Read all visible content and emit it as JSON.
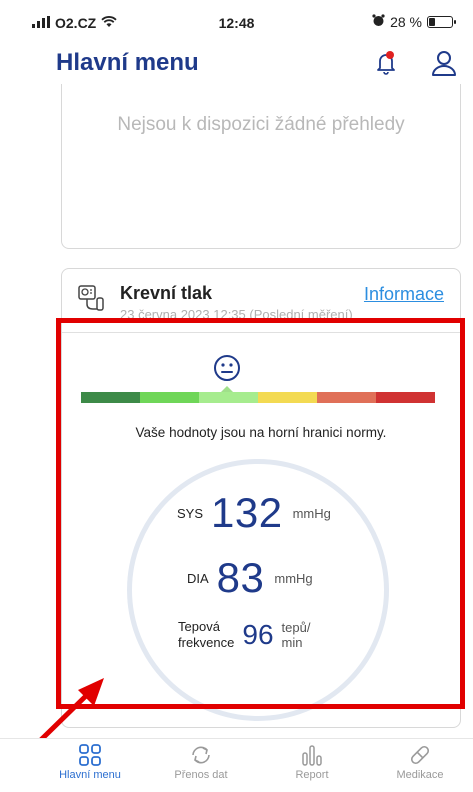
{
  "status_bar": {
    "carrier": "O2.CZ",
    "time": "12:48",
    "battery": "28 %",
    "battery_level": 0.28
  },
  "header": {
    "title": "Hlavní menu",
    "notification_badge_color": "#e02020",
    "icons": [
      "bell-icon",
      "user-icon"
    ]
  },
  "overview_card": {
    "empty_message": "Nejsou k dispozici žádné přehledy"
  },
  "blood_pressure": {
    "title": "Krevní tlak",
    "info_link": "Informace",
    "date": "23 června 2023 12:35 (Poslední měření)",
    "status_message": "Vaše hodnoty jsou na horní hranici normy.",
    "mood": "neutral-face-icon",
    "scale_colors": [
      "#3d8a48",
      "#6fd658",
      "#a6ec8e",
      "#f3da52",
      "#e07058",
      "#d03232"
    ],
    "active_segment_index": 2,
    "sys_label": "SYS",
    "sys_value": "132",
    "sys_unit": "mmHg",
    "dia_label": "DIA",
    "dia_value": "83",
    "dia_unit": "mmHg",
    "pulse_label_line1": "Tepová",
    "pulse_label_line2": "frekvence",
    "pulse_value": "96",
    "pulse_unit_line1": "tepů/",
    "pulse_unit_line2": "min"
  },
  "tabs": [
    {
      "label": "Hlavní menu",
      "icon": "dashboard-icon",
      "active": true
    },
    {
      "label": "Přenos dat",
      "icon": "sync-icon",
      "active": false
    },
    {
      "label": "Report",
      "icon": "report-icon",
      "active": false
    },
    {
      "label": "Medikace",
      "icon": "pill-icon",
      "active": false
    }
  ],
  "colors": {
    "accent": "#1f3a8a",
    "link": "#2c8ee0",
    "active_tab": "#2c6fd0",
    "highlight_annotation": "#e10000"
  }
}
